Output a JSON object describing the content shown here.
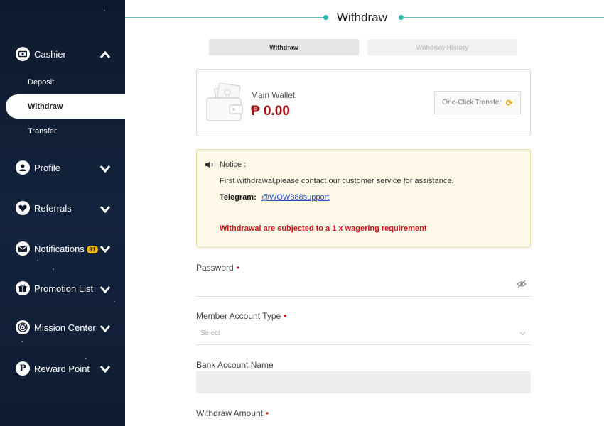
{
  "sidebar": {
    "cashier": {
      "label": "Cashier",
      "icon": "cashier-icon",
      "expanded": true
    },
    "sub_items": {
      "deposit": "Deposit",
      "withdraw": "Withdraw",
      "transfer": "Transfer"
    },
    "active_sub_item": "Withdraw",
    "items": [
      {
        "label": "Profile",
        "icon": "user-icon"
      },
      {
        "label": "Referrals",
        "icon": "heart-icon"
      },
      {
        "label": "Notifications",
        "icon": "mail-icon",
        "badge": "81"
      },
      {
        "label": "Promotion List",
        "icon": "gift-icon"
      },
      {
        "label": "Mission Center",
        "icon": "target-icon"
      },
      {
        "label": "Reward Point",
        "icon": "points-icon",
        "icon_glyph": "P"
      }
    ]
  },
  "main": {
    "title": "Withdraw",
    "tabs": [
      {
        "label": "Withdraw",
        "active": true
      },
      {
        "label": "Withdraw History",
        "active": false
      }
    ],
    "wallet": {
      "label": "Main Wallet",
      "amount": "₱ 0.00",
      "transfer_button": "One-Click Transfer"
    },
    "notice": {
      "heading": "Notice :",
      "line1": "First withdrawal,please contact our customer service for assistance.",
      "telegram_label": "Telegram:",
      "telegram_handle": "@WOW888support",
      "warning": "Withdrawal are subjected to a 1 x wagering requirement"
    },
    "form": {
      "password": {
        "label": "Password",
        "required_mark": "•",
        "value": ""
      },
      "member_account_type": {
        "label": "Member Account Type",
        "required_mark": "•",
        "placeholder": "Select"
      },
      "bank_account_name": {
        "label": "Bank Account Name",
        "value": ""
      },
      "withdraw_amount": {
        "label": "Withdraw Amount",
        "required_mark": "•"
      }
    }
  },
  "colors": {
    "accent_teal": "#2bb9b0",
    "amount_red": "#9b0f0f",
    "warning_red": "#d3131a",
    "badge_yellow": "#f0b400",
    "sidebar_bg": "#0d1a2e"
  }
}
